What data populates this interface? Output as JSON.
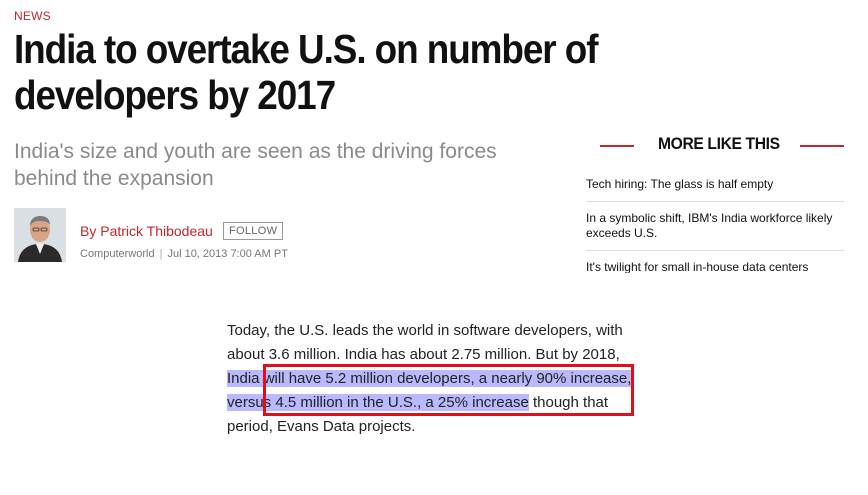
{
  "section": "NEWS",
  "headline": "India to overtake U.S. on number of developers by 2017",
  "dek": "India's size and youth are seen as the driving forces behind the expansion",
  "byline": {
    "author": "By Patrick Thibodeau",
    "follow": "FOLLOW",
    "publication": "Computerworld",
    "date": "Jul 10, 2013 7:00 AM PT"
  },
  "more_like_this": {
    "title": "MORE LIKE THIS",
    "items": [
      "Tech hiring: The glass is half empty",
      "In a symbolic shift, IBM's India workforce likely exceeds U.S.",
      "It's twilight for small in-house data centers"
    ]
  },
  "article": {
    "text_before": "Today, the U.S. leads the world in software developers, with about 3.6 million. India has about 2.75 million. But by 2018,",
    "highlight": " India will have 5.2 million developers, a nearly 90% increase, versus 4.5 million in the U.S., a 25% increase",
    "text_after": " though that period, Evans Data projects."
  },
  "colors": {
    "accent": "#c0282d",
    "highlight": "#b9b9ff",
    "annotation_box": "#e0101a"
  }
}
